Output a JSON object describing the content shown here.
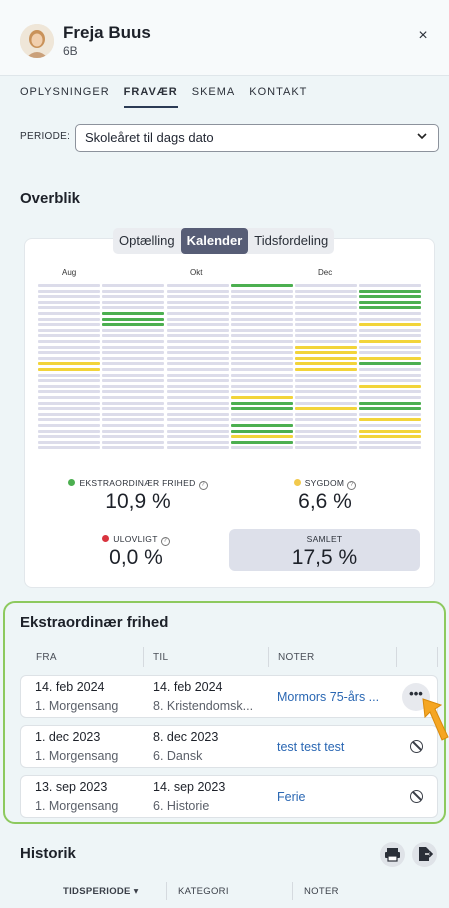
{
  "header": {
    "student_name": "Freja Buus",
    "student_class": "6B",
    "close_label": "×"
  },
  "tabs": [
    {
      "label": "OPLYSNINGER",
      "active": false
    },
    {
      "label": "FRAVÆR",
      "active": true
    },
    {
      "label": "SKEMA",
      "active": false
    },
    {
      "label": "KONTAKT",
      "active": false
    }
  ],
  "periode": {
    "label": "PERIODE:",
    "value": "Skoleåret til dags dato"
  },
  "overview": {
    "title": "Overblik",
    "view_options": [
      "Optælling",
      "Kalender",
      "Tidsfordeling"
    ],
    "active_view": "Kalender",
    "months": [
      "Aug",
      "Okt",
      "Dec"
    ],
    "stats": {
      "ekstraordinaer": {
        "label": "EKSTRAORDINÆR FRIHED",
        "value": "10,9 %",
        "color": "#4caf50"
      },
      "sygdom": {
        "label": "SYGDOM",
        "value": "6,6 %",
        "color": "#f2c94c"
      },
      "ulovligt": {
        "label": "ULOVLIGT",
        "value": "0,0 %",
        "color": "#d9343f"
      },
      "samlet": {
        "label": "SAMLET",
        "value": "17,5 %"
      }
    },
    "colors": {
      "green": "#4caf50",
      "yellow": "#f2d43a",
      "empty": "#dcdcea"
    }
  },
  "ekstra": {
    "title": "Ekstraordinær frihed",
    "columns": [
      "FRA",
      "TIL",
      "NOTER"
    ],
    "rows": [
      {
        "fra_date": "14. feb 2024",
        "fra_lesson": "1. Morgensang",
        "til_date": "14. feb 2024",
        "til_lesson": "8. Kristendomsk...",
        "note": "Mormors 75-års ...",
        "action": "more"
      },
      {
        "fra_date": "1. dec 2023",
        "fra_lesson": "1. Morgensang",
        "til_date": "8. dec 2023",
        "til_lesson": "6. Dansk",
        "note": "test test test",
        "action": "ban"
      },
      {
        "fra_date": "13. sep 2023",
        "fra_lesson": "1. Morgensang",
        "til_date": "14. sep 2023",
        "til_lesson": "6. Historie",
        "note": "Ferie",
        "action": "ban"
      }
    ]
  },
  "historik": {
    "title": "Historik",
    "columns": [
      "TIDSPERIODE ▾",
      "KATEGORI",
      "NOTER"
    ]
  },
  "icons": {
    "more": "•••"
  }
}
